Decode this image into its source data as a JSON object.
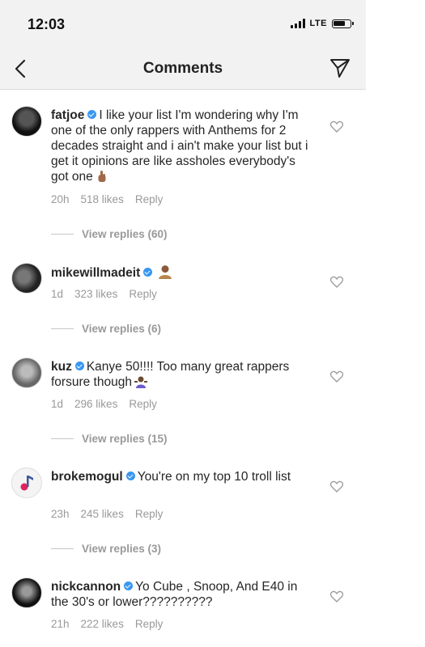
{
  "status_bar": {
    "time": "12:03",
    "network": "LTE"
  },
  "nav": {
    "title": "Comments"
  },
  "comments": [
    {
      "username": "fatjoe",
      "text": "I like your list I'm wondering why I'm one of the only rappers with Anthems for 2 decades straight and i ain't make your list but i get it opinions are like assholes everybody's got one",
      "emoji": "hand-emoji",
      "time": "20h",
      "likes": "518 likes",
      "reply": "Reply",
      "view_replies": "View replies (60)"
    },
    {
      "username": "mikewillmadeit",
      "text": "",
      "emoji": "person-emoji",
      "time": "1d",
      "likes": "323 likes",
      "reply": "Reply",
      "view_replies": "View replies (6)"
    },
    {
      "username": "kuz",
      "text": "Kanye 50!!!! Too many great rappers forsure though",
      "emoji": "shrug-emoji",
      "time": "1d",
      "likes": "296 likes",
      "reply": "Reply",
      "view_replies": "View replies (15)"
    },
    {
      "username": "brokemogul",
      "text": "You're on my top 10 troll list",
      "emoji": "",
      "time": "23h",
      "likes": "245 likes",
      "reply": "Reply",
      "view_replies": "View replies (3)"
    },
    {
      "username": "nickcannon",
      "text": "Yo Cube , Snoop, And E40 in the 30's or lower??????????",
      "emoji": "",
      "time": "21h",
      "likes": "222 likes",
      "reply": "Reply",
      "view_replies": ""
    }
  ],
  "colors": {
    "verified": "#3897f0",
    "meta_text": "#999999",
    "header_bg": "#f2f2f2"
  }
}
